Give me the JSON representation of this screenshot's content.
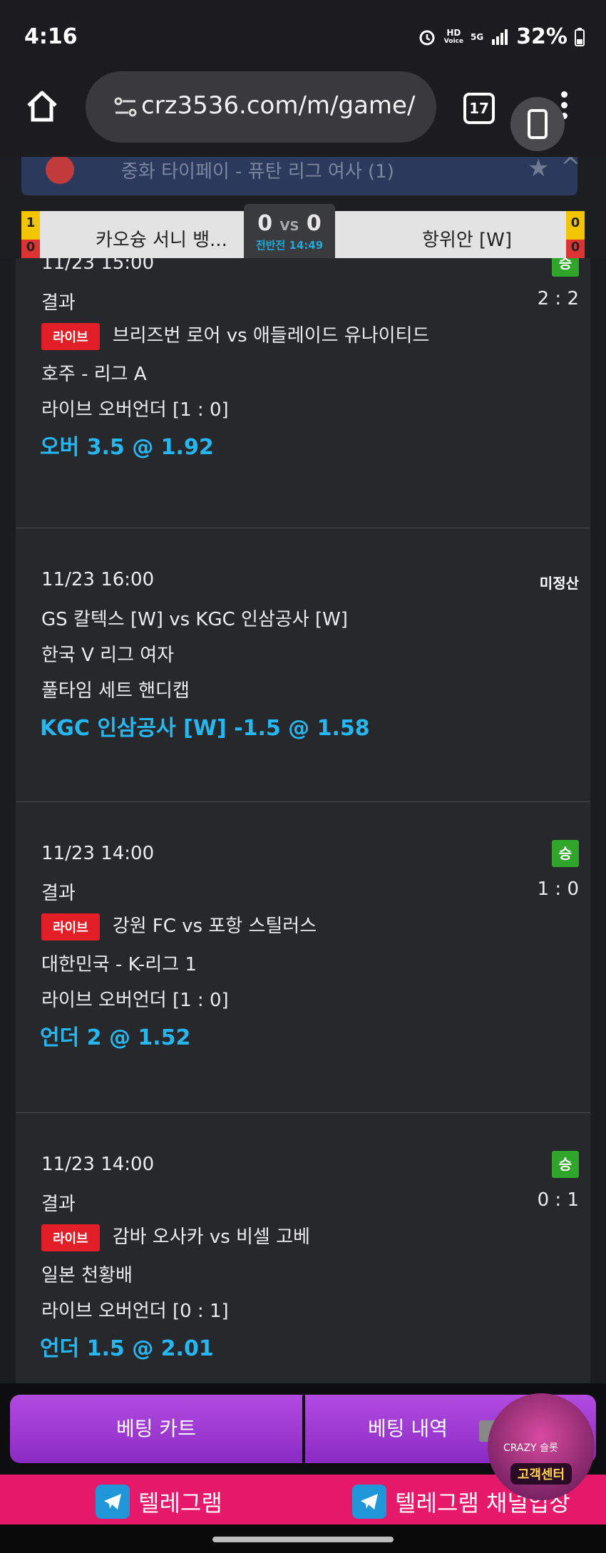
{
  "status_bar": {
    "time": "4:16",
    "net_hd": "HD",
    "net_voice": "Voice",
    "net_5g": "5G",
    "battery": "32%"
  },
  "browser": {
    "url": "crz3536.com/m/game/",
    "tab_count": "17"
  },
  "sticky_match": {
    "league": "중화 타이페이 - 퓨탄 리그 여사 (1)",
    "home_team": "카오슝 서니 뱅...",
    "away_team": "항위안 [W]",
    "home_score": "0",
    "vs": "VS",
    "away_score": "0",
    "period": "전반전 14:49",
    "home_side_top": "1",
    "home_side_bottom": "0",
    "away_side_top": "0",
    "away_side_bottom": "0"
  },
  "bets": [
    {
      "datetime": "11/23 15:00",
      "status": "승",
      "result_label": "결과",
      "result_score": "2 : 2",
      "live": "라이브",
      "match": "브리즈번 로어 vs 애들레이드 유나이티드",
      "league": "호주 - 리그 A",
      "market": "라이브 오버언더 [1 : 0]",
      "pick": "오버 3.5 @ 1.92"
    },
    {
      "datetime": "11/23 16:00",
      "status": "미정산",
      "match": "GS 칼텍스 [W] vs KGC 인삼공사 [W]",
      "league": "한국 V 리그 여자",
      "market": "풀타임 세트 핸디캡",
      "pick": "KGC 인삼공사 [W] -1.5 @ 1.58"
    },
    {
      "datetime": "11/23 14:00",
      "status": "승",
      "result_label": "결과",
      "result_score": "1 : 0",
      "live": "라이브",
      "match": "강원 FC vs 포항 스틸러스",
      "league": "대한민국 - K-리그 1",
      "market": "라이브 오버언더 [1 : 0]",
      "pick": "언더 2 @ 1.52"
    },
    {
      "datetime": "11/23 14:00",
      "status": "승",
      "result_label": "결과",
      "result_score": "0 : 1",
      "live": "라이브",
      "match": "감바 오사카 vs 비셀 고베",
      "league": "일본 천황배",
      "market": "라이브 오버언더 [0 : 1]",
      "pick": "언더 1.5 @ 2.01"
    }
  ],
  "bottom": {
    "bet_cart": "베팅 카트",
    "bet_history": "베팅 내역"
  },
  "telegram": {
    "left": "텔레그램",
    "right": "텔레그램 채널입장"
  },
  "mascot": {
    "brand": "CRAZY 슬롯",
    "label": "고객센터"
  },
  "colors": {
    "accent_pick": "#27b7f0",
    "live_badge": "#e21f26",
    "win_badge": "#2fa62a",
    "bet_button": "#9b3ad4",
    "telegram_bar": "#e5186a"
  }
}
